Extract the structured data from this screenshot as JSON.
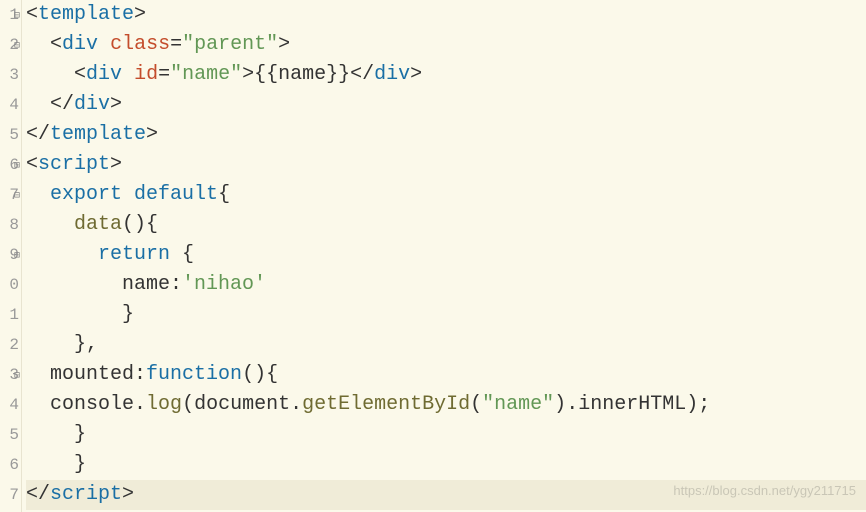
{
  "gutter": [
    "1",
    "2",
    "3",
    "4",
    "5",
    "6",
    "7",
    "8",
    "9",
    "0",
    "1",
    "2",
    "3",
    "4",
    "5",
    "6",
    "7"
  ],
  "fold_rows": [
    0,
    1,
    5,
    6,
    8,
    12
  ],
  "code": {
    "l1": {
      "open": "<",
      "tag": "template",
      "close": ">"
    },
    "l2": {
      "indent": "  ",
      "open": "<",
      "tag": "div",
      "sp": " ",
      "attr": "class",
      "eq": "=",
      "val": "\"parent\"",
      "close": ">"
    },
    "l3": {
      "indent": "    ",
      "open": "<",
      "tag": "div",
      "sp": " ",
      "attr": "id",
      "eq": "=",
      "val": "\"name\"",
      "close": ">",
      "text": "{{name}}",
      "open2": "</",
      "tag2": "div",
      "close2": ">"
    },
    "l4": {
      "indent": "  ",
      "open": "</",
      "tag": "div",
      "close": ">"
    },
    "l5": {
      "open": "</",
      "tag": "template",
      "close": ">"
    },
    "l6": {
      "open": "<",
      "tag": "script",
      "close": ">"
    },
    "l7": {
      "indent": "  ",
      "kw1": "export",
      "sp1": " ",
      "kw2": "default",
      "brace": "{"
    },
    "l8": {
      "indent": "    ",
      "fn": "data",
      "parens": "()",
      "brace": "{"
    },
    "l9": {
      "indent": "      ",
      "kw": "return",
      "sp": " ",
      "brace": "{"
    },
    "l10": {
      "indent": "        ",
      "key": "name",
      "colon": ":",
      "val": "'nihao'"
    },
    "l11": {
      "indent": "        ",
      "brace": "}"
    },
    "l12": {
      "indent": "    ",
      "brace": "}",
      "comma": ","
    },
    "l13": {
      "indent": "  ",
      "key": "mounted",
      "colon": ":",
      "kw": "function",
      "parens": "()",
      "brace": "{"
    },
    "l14": {
      "indent": "  ",
      "obj": "console",
      "dot1": ".",
      "m1": "log",
      "p1": "(",
      "obj2": "document",
      "dot2": ".",
      "m2": "getElementById",
      "p2": "(",
      "str": "\"name\"",
      "p3": ")",
      "dot3": ".",
      "prop": "innerHTML",
      "p4": ");"
    },
    "l15": {
      "indent": "    ",
      "brace": "}"
    },
    "l16": {
      "indent": "    ",
      "brace": "}"
    },
    "l17": {
      "open": "</",
      "tag": "script",
      "close": ">"
    }
  },
  "watermark": "https://blog.csdn.net/ygy211715"
}
